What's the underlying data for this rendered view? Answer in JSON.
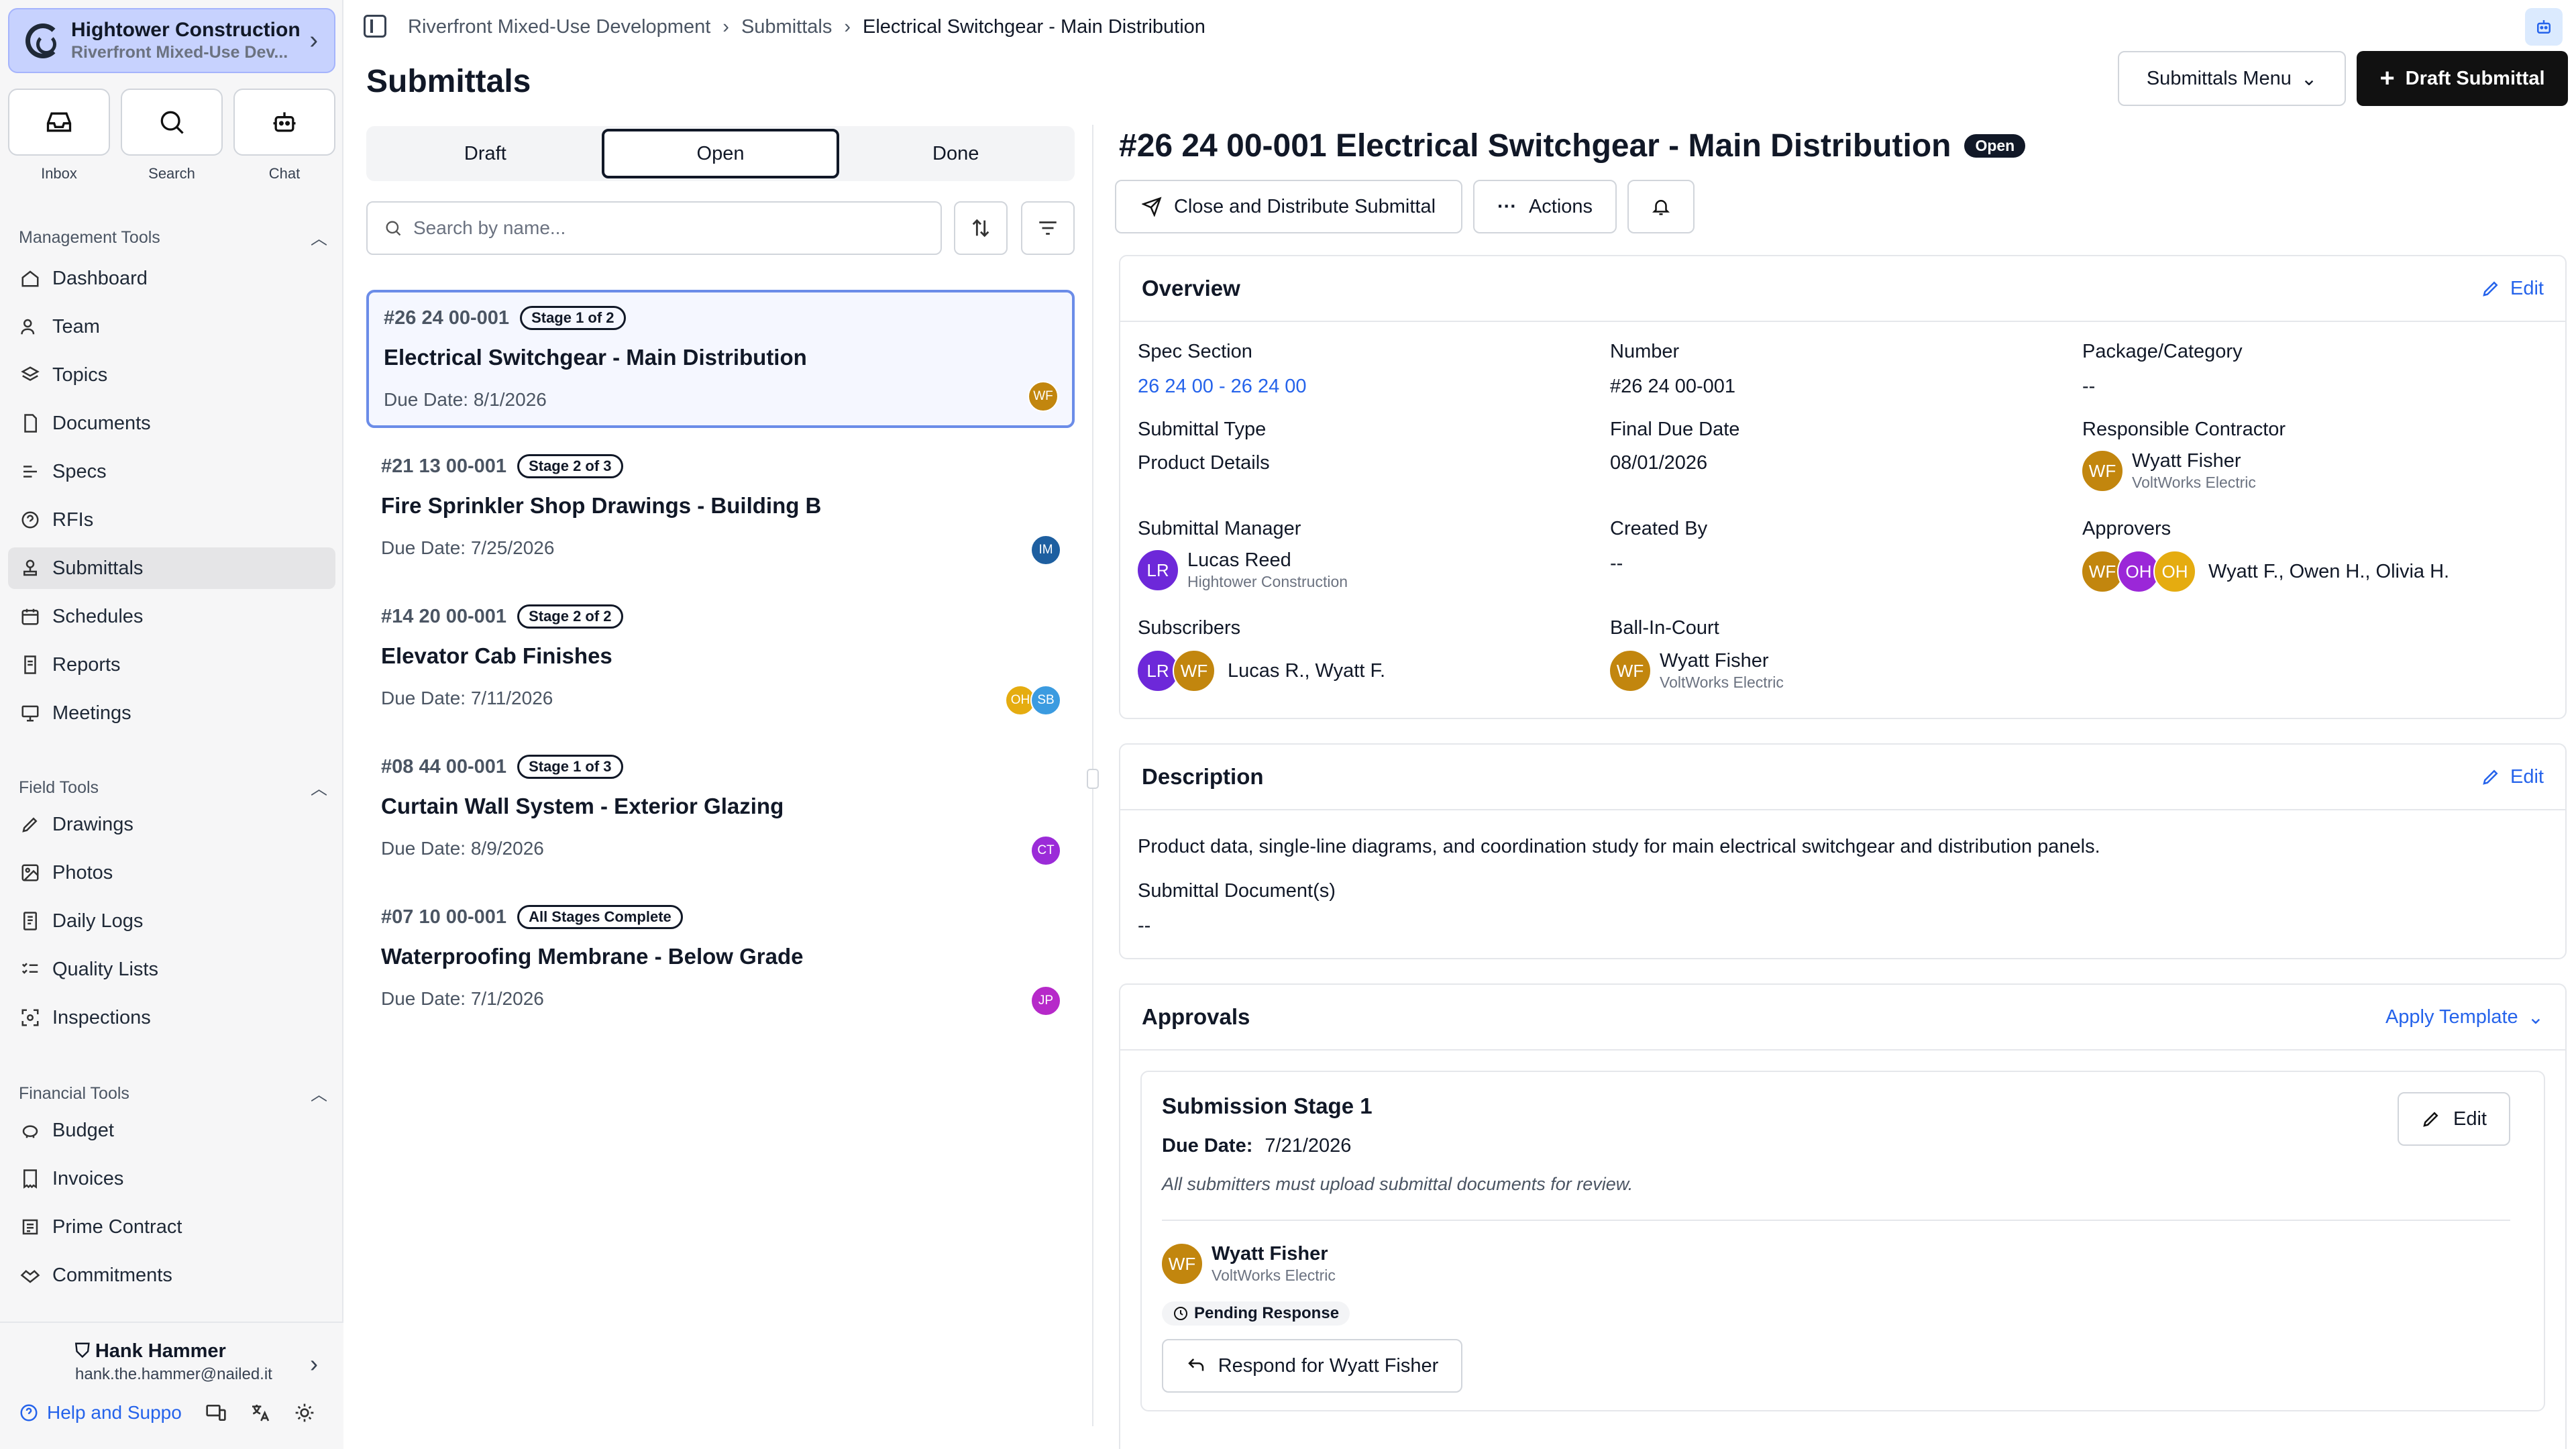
{
  "project": {
    "company": "Hightower Construction",
    "name": "Riverfront Mixed-Use Dev..."
  },
  "quick_actions": [
    {
      "label": "Inbox",
      "icon": "inbox-icon"
    },
    {
      "label": "Search",
      "icon": "search-icon"
    },
    {
      "label": "Chat",
      "icon": "robot-icon"
    }
  ],
  "sections": {
    "management": "Management Tools",
    "field": "Field Tools",
    "financial": "Financial Tools"
  },
  "management_items": [
    {
      "label": "Dashboard",
      "icon": "home-icon"
    },
    {
      "label": "Team",
      "icon": "users-icon"
    },
    {
      "label": "Topics",
      "icon": "layers-icon"
    },
    {
      "label": "Documents",
      "icon": "file-icon"
    },
    {
      "label": "Specs",
      "icon": "specs-icon"
    },
    {
      "label": "RFIs",
      "icon": "rfi-icon"
    },
    {
      "label": "Submittals",
      "icon": "stamp-icon"
    },
    {
      "label": "Schedules",
      "icon": "calendar-icon"
    },
    {
      "label": "Reports",
      "icon": "report-icon"
    },
    {
      "label": "Meetings",
      "icon": "presentation-icon"
    }
  ],
  "field_items": [
    {
      "label": "Drawings",
      "icon": "drawing-icon"
    },
    {
      "label": "Photos",
      "icon": "photo-icon"
    },
    {
      "label": "Daily Logs",
      "icon": "log-icon"
    },
    {
      "label": "Quality Lists",
      "icon": "checklist-icon"
    },
    {
      "label": "Inspections",
      "icon": "scan-icon"
    }
  ],
  "financial_items": [
    {
      "label": "Budget",
      "icon": "piggybank-icon"
    },
    {
      "label": "Invoices",
      "icon": "invoice-icon"
    },
    {
      "label": "Prime Contract",
      "icon": "contract-icon"
    },
    {
      "label": "Commitments",
      "icon": "handshake-icon"
    }
  ],
  "user": {
    "name": "Hank Hammer",
    "email": "hank.the.hammer@nailed.it",
    "help": "Help and Suppo"
  },
  "breadcrumb": [
    "Riverfront Mixed-Use Development",
    "Submittals",
    "Electrical Switchgear - Main Distribution"
  ],
  "page_title": "Submittals",
  "buttons": {
    "menu": "Submittals Menu",
    "draft": "Draft Submittal"
  },
  "tabs": [
    "Draft",
    "Open",
    "Done"
  ],
  "search_placeholder": "Search by name...",
  "submittals": [
    {
      "number": "#26 24 00-001",
      "stage": "Stage 1 of 2",
      "title": "Electrical Switchgear - Main Distribution",
      "due": "Due Date: 8/1/2026",
      "avatars": [
        {
          "initials": "WF",
          "color": "#c2860e"
        }
      ]
    },
    {
      "number": "#21 13 00-001",
      "stage": "Stage 2 of 3",
      "title": "Fire Sprinkler Shop Drawings - Building B",
      "due": "Due Date: 7/25/2026",
      "avatars": [
        {
          "initials": "IM",
          "color": "#1e5fa0"
        }
      ]
    },
    {
      "number": "#14 20 00-001",
      "stage": "Stage 2 of 2",
      "title": "Elevator Cab Finishes",
      "due": "Due Date: 7/11/2026",
      "avatars": [
        {
          "initials": "OH",
          "color": "#e5ac10"
        },
        {
          "initials": "SB",
          "color": "#3b9be0"
        }
      ]
    },
    {
      "number": "#08 44 00-001",
      "stage": "Stage 1 of 3",
      "title": "Curtain Wall System - Exterior Glazing",
      "due": "Due Date: 8/9/2026",
      "avatars": [
        {
          "initials": "CT",
          "color": "#9b2bd8"
        }
      ]
    },
    {
      "number": "#07 10 00-001",
      "stage": "All Stages Complete",
      "title": "Waterproofing Membrane - Below Grade",
      "due": "Due Date: 7/1/2026",
      "avatars": [
        {
          "initials": "JP",
          "color": "#b629c9"
        }
      ]
    }
  ],
  "detail": {
    "title": "#26 24 00-001 Electrical Switchgear - Main Distribution",
    "status": "Open",
    "close_btn": "Close and Distribute Submittal",
    "actions_btn": "Actions",
    "overview": {
      "title": "Overview",
      "edit": "Edit",
      "spec_section_label": "Spec Section",
      "spec_section": "26 24 00 - 26 24 00",
      "number_label": "Number",
      "number": "#26 24 00-001",
      "package_label": "Package/Category",
      "package": "--",
      "type_label": "Submittal Type",
      "type": "Product Details",
      "due_label": "Final Due Date",
      "due": "08/01/2026",
      "contractor_label": "Responsible Contractor",
      "contractor_name": "Wyatt Fisher",
      "contractor_org": "VoltWorks Electric",
      "manager_label": "Submittal Manager",
      "manager_name": "Lucas Reed",
      "manager_org": "Hightower Construction",
      "created_label": "Created By",
      "created": "--",
      "approvers_label": "Approvers",
      "approvers": "Wyatt F., Owen H., Olivia H.",
      "subscribers_label": "Subscribers",
      "subscribers": "Lucas R., Wyatt F.",
      "ballincourt_label": "Ball-In-Court",
      "bic_name": "Wyatt Fisher",
      "bic_org": "VoltWorks Electric"
    },
    "description": {
      "title": "Description",
      "edit": "Edit",
      "text": "Product data, single-line diagrams, and coordination study for main electrical switchgear and distribution panels.",
      "docs_label": "Submittal Document(s)",
      "docs": "--"
    },
    "approvals": {
      "title": "Approvals",
      "apply_template": "Apply Template",
      "stage_title": "Submission Stage 1",
      "due_label": "Due Date:",
      "due": "7/21/2026",
      "note": "All submitters must upload submittal documents for review.",
      "edit": "Edit",
      "submitter_name": "Wyatt Fisher",
      "submitter_org": "VoltWorks Electric",
      "pending": "Pending Response",
      "respond": "Respond for Wyatt Fisher"
    }
  },
  "avatar_initials": {
    "wf": "WF",
    "lr": "LR",
    "oh": "OH"
  },
  "colors": {
    "wf": "#c2860e",
    "lr": "#6d28d9",
    "oh_purple": "#9b27d8",
    "oh_yellow": "#e5ac10",
    "link": "#2563eb",
    "active_nav": "#e5e5e7",
    "project_bg": "#c7d2fe"
  }
}
